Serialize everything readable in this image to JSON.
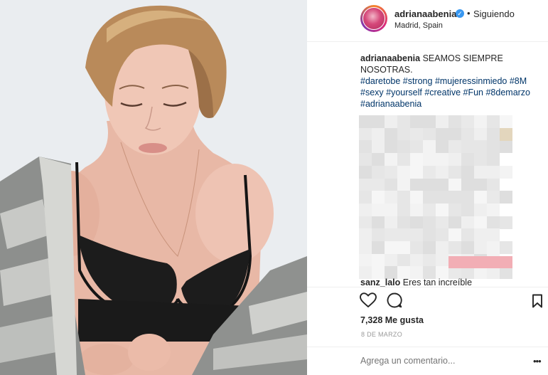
{
  "post": {
    "username": "adrianaabenia",
    "follow_status": "Siguiendo",
    "location": "Madrid, Spain",
    "caption_user": "adrianaabenia",
    "caption_text": "SEAMOS SIEMPRE NOSOTRAS.",
    "hashtags": "#daretobe #strong #mujeressinmiedo #8M #sexy #yourself #creative #Fun #8demarzo #adrianaabenia",
    "visible_comment_user": "sanz_lalo",
    "visible_comment_text": "Eres tan increíble",
    "likes": "7,328 Me gusta",
    "date": "8 DE MARZO",
    "comment_placeholder": "Agrega un comentario...",
    "more_label": "•••"
  },
  "icons": {
    "heart": "heart-icon",
    "comment": "comment-icon",
    "bookmark": "bookmark-icon",
    "verified": "verified-badge-icon"
  },
  "colors": {
    "link": "#003569",
    "verified": "#3897f0",
    "muted": "#999999"
  }
}
